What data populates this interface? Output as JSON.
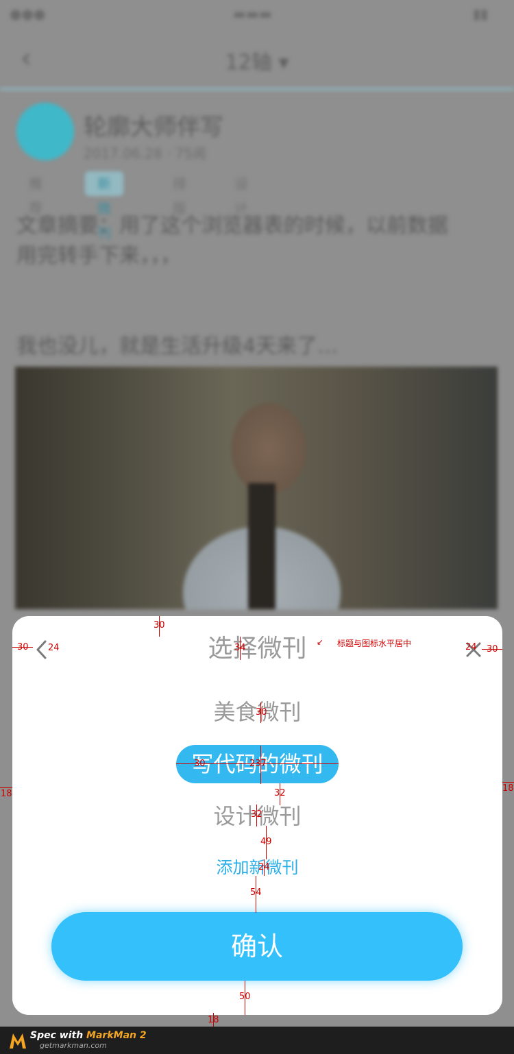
{
  "background": {
    "nav_title": "12轴 ▾",
    "author_name": "轮廓大师伴写",
    "post_meta": "2017.06.28 · 75阅",
    "tags": [
      "推荐",
      "新微刊",
      "排版",
      "设计"
    ],
    "post_lines": [
      "文章摘要：用了这个浏览器表的时候，以前数据",
      "用完转手下来，，，",
      "我也没儿，就是生活升级4天来了…"
    ]
  },
  "sheet": {
    "title": "选择微刊",
    "options": [
      {
        "label": "美食微刊",
        "selected": false
      },
      {
        "label": "写代码的微刊",
        "selected": true
      },
      {
        "label": "设计微刊",
        "selected": false
      }
    ],
    "add_link": "添加新微刊",
    "confirm": "确认"
  },
  "colors": {
    "accent": "#33b8f0",
    "confirm": "#33c0fb",
    "text_muted": "#9a9a9a",
    "annotation": "#d00000"
  },
  "icons": {
    "back": "chevron-left-icon",
    "close": "close-icon"
  },
  "annotations": {
    "title_note": "标题与图标水平居中",
    "measures": [
      "30",
      "30",
      "24",
      "34",
      "24",
      "30",
      "30",
      "237",
      "30",
      "18",
      "18",
      "32",
      "32",
      "49",
      "24",
      "54",
      "50",
      "18"
    ]
  },
  "footer": {
    "brand_prefix": "Spec with ",
    "brand_name": "MarkMan 2",
    "url": "getmarkman.com"
  }
}
